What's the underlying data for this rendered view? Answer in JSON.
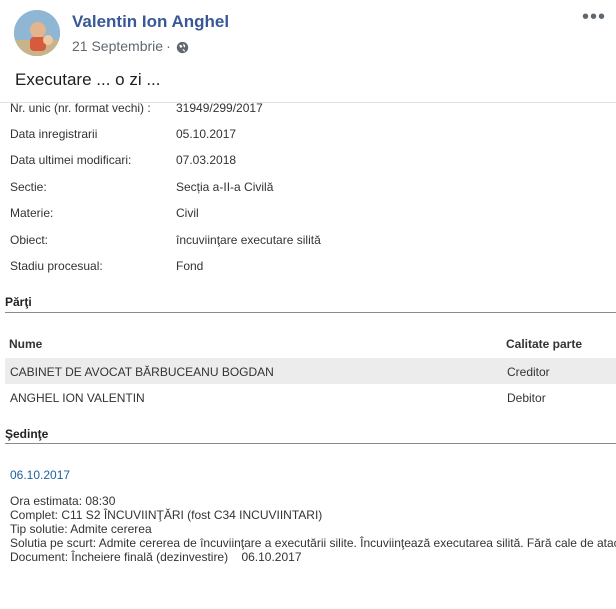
{
  "post": {
    "author": "Valentin Ion Anghel",
    "date": "21 Septembrie",
    "separator": "·",
    "text": "Executare ... o zi ...",
    "menu": "•••"
  },
  "dosar": {
    "fields": [
      {
        "label": "Nr. unic (nr. format vechi) :",
        "value": "31949/299/2017"
      },
      {
        "label": "Data inregistrarii",
        "value": "05.10.2017"
      },
      {
        "label": "Data ultimei modificari:",
        "value": "07.03.2018"
      },
      {
        "label": "Sectie:",
        "value": "Secția a-II-a Civilă"
      },
      {
        "label": "Materie:",
        "value": "Civil"
      },
      {
        "label": "Obiect:",
        "value": "încuviinţare executare silită"
      },
      {
        "label": "Stadiu procesual:",
        "value": "Fond"
      }
    ]
  },
  "parti": {
    "title": "Părţi",
    "col_name": "Nume",
    "col_role": "Calitate parte",
    "rows": [
      {
        "name": "CABINET DE AVOCAT BĂRBUCEANU BOGDAN",
        "role": "Creditor"
      },
      {
        "name": "ANGHEL ION VALENTIN",
        "role": "Debitor"
      }
    ]
  },
  "sedinte": {
    "title": "Şedinţe",
    "date": "06.10.2017",
    "lines": [
      "Ora estimata: 08:30",
      "Complet: C11 S2 ÎNCUVIINŢĂRI (fost C34 INCUVIINTARI)",
      "Tip solutie: Admite cererea",
      "Solutia pe scurt: Admite cererea de încuviinţare a executării silite. Încuviinţează executarea silită. Fără cale de atac.",
      "Document: Încheiere finală (dezinvestire)    06.10.2017"
    ]
  }
}
